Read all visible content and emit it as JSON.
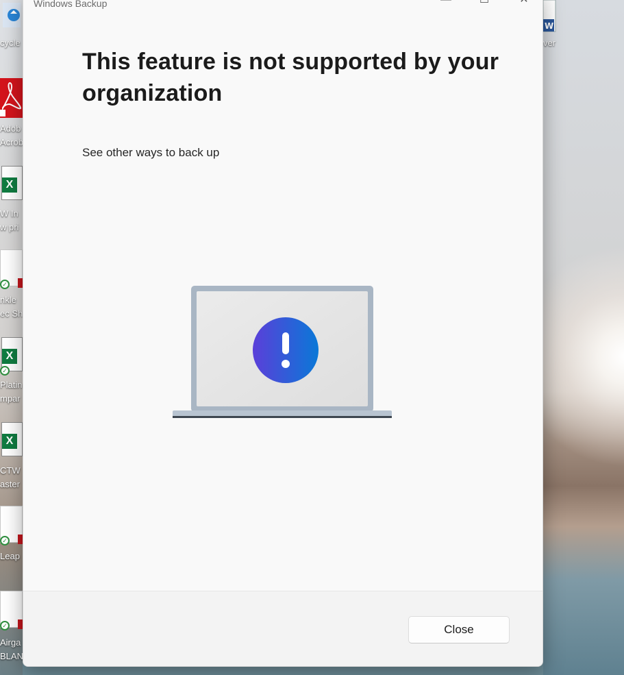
{
  "window": {
    "title": "Windows Backup",
    "controls": {
      "minimize": "—",
      "maximize": "☐",
      "close": "✕"
    }
  },
  "main": {
    "heading": "This feature is not supported by your organization",
    "link_text": "See other ways to back up",
    "illustration_icon": "laptop-warning-icon"
  },
  "footer": {
    "close_label": "Close"
  },
  "desktop": {
    "left_icons": [
      {
        "label_1": "cycle",
        "icon": "recycle-bin-icon"
      },
      {
        "label_1": "Adob",
        "label_2": "Acrob",
        "icon": "pdf-icon"
      },
      {
        "label_1": "W In",
        "label_2": "w pri",
        "icon": "excel-icon"
      },
      {
        "label_1": "nkle",
        "label_2": "ec Sh",
        "icon": "pdf-icon"
      },
      {
        "label_1": "Platin",
        "label_2": "mpar",
        "icon": "excel-icon"
      },
      {
        "label_1": "CTW",
        "label_2": "aster",
        "icon": "excel-icon"
      },
      {
        "label_1": "Leap",
        "icon": "pdf-icon"
      },
      {
        "label_1": "Airga",
        "label_2": "BLAN",
        "icon": "pdf-icon"
      }
    ],
    "right_icons": [
      {
        "label_1": "ver",
        "icon": "word-icon"
      }
    ]
  },
  "colors": {
    "accent_gradient_start": "#5b3fd9",
    "accent_gradient_end": "#0a78d7",
    "laptop_frame": "#a7b4c2"
  }
}
